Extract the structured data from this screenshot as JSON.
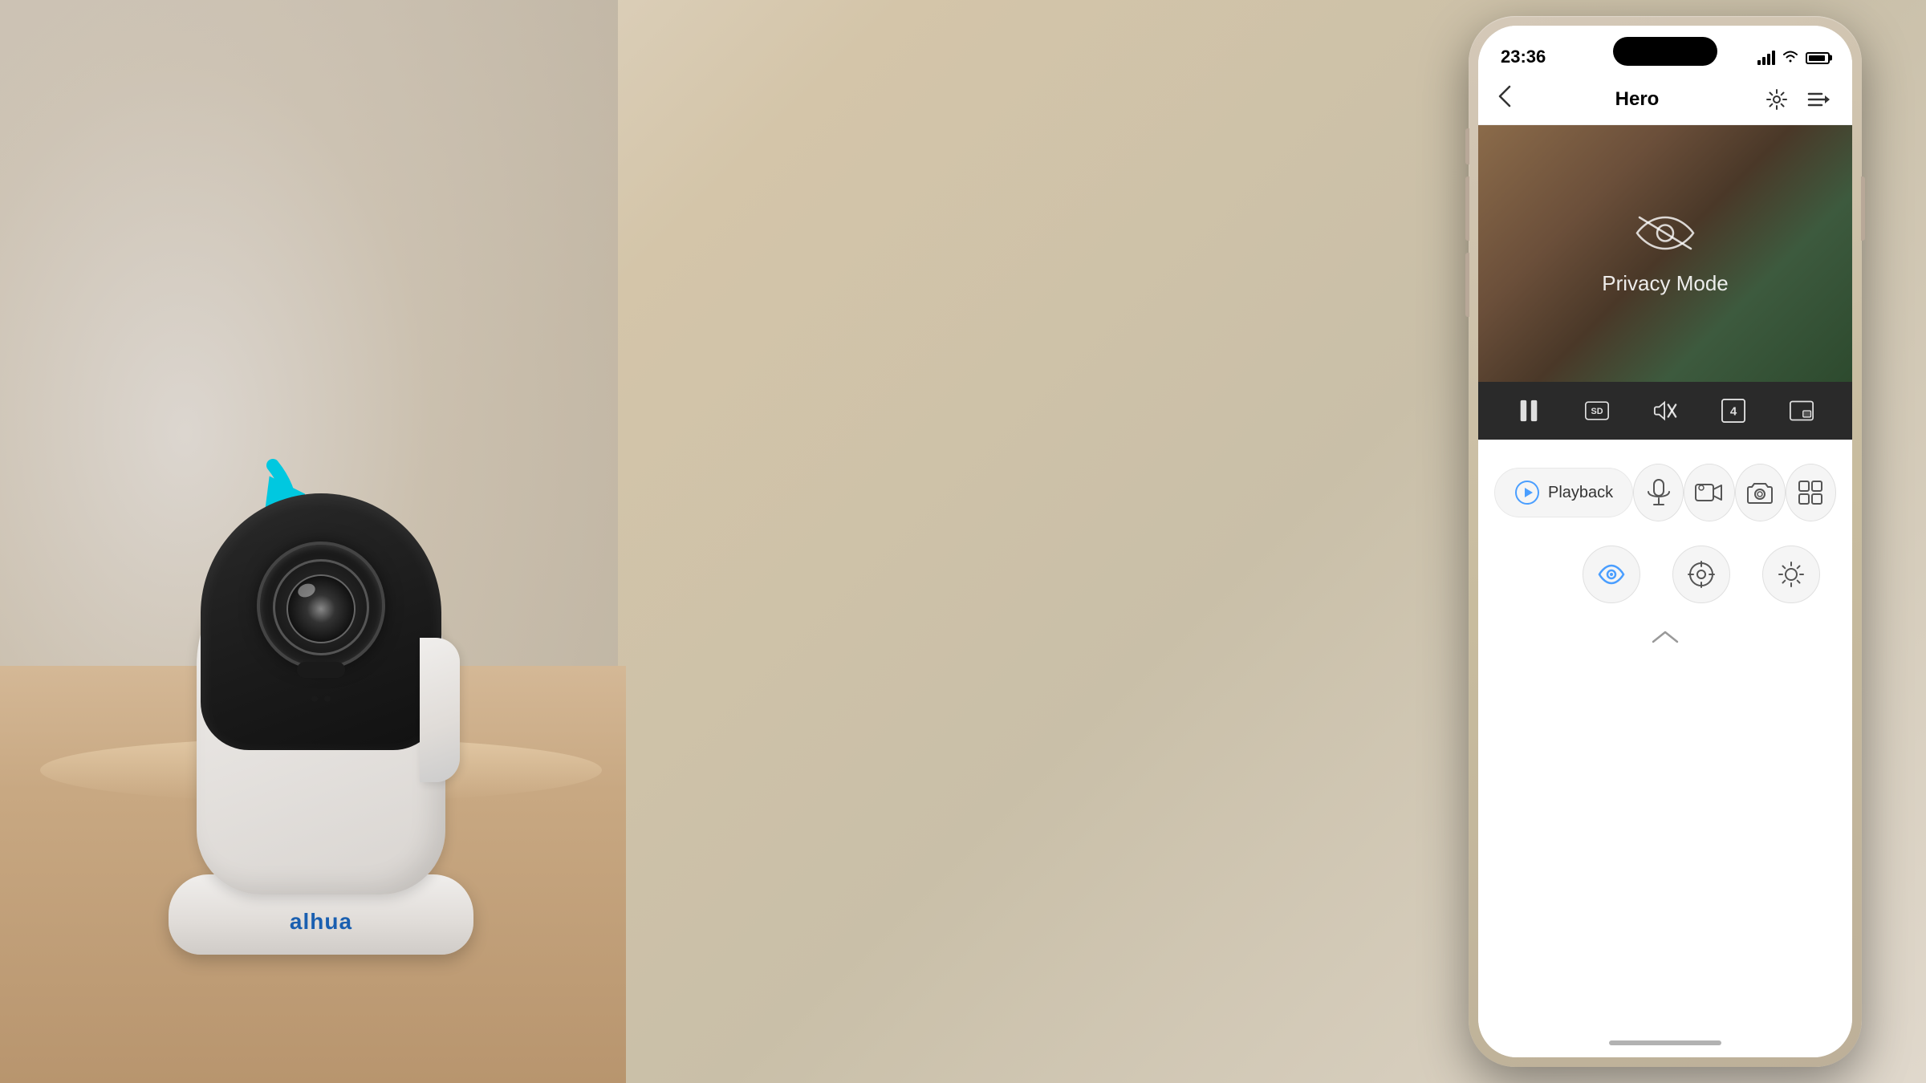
{
  "background": {
    "desc": "home background blur"
  },
  "camera": {
    "brand": "alhua",
    "brand_symbol": "a"
  },
  "phone": {
    "status_bar": {
      "time": "23:36",
      "signal_label": "signal",
      "wifi_label": "wifi",
      "battery_label": "battery"
    },
    "nav": {
      "title": "Hero",
      "back_label": "‹",
      "settings_label": "settings",
      "menu_label": "menu"
    },
    "video": {
      "privacy_text": "Privacy Mode",
      "privacy_icon_label": "privacy-eye"
    },
    "controls": {
      "pause_label": "pause",
      "sd_label": "SD",
      "mute_label": "mute",
      "quality_label": "4",
      "split_label": "split"
    },
    "actions": {
      "playback_label": "Playback",
      "mic_label": "microphone",
      "video_record_label": "video",
      "snapshot_label": "snapshot",
      "grid_label": "grid"
    },
    "second_row": {
      "eye_label": "privacy toggle",
      "ptz_label": "ptz",
      "light_label": "light"
    },
    "chevron": {
      "label": "expand"
    }
  }
}
